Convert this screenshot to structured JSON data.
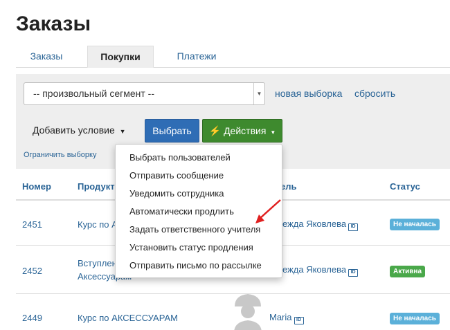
{
  "page": {
    "title": "Заказы"
  },
  "tabs": [
    {
      "label": "Заказы",
      "active": false
    },
    {
      "label": "Покупки",
      "active": true
    },
    {
      "label": "Платежи",
      "active": false
    }
  ],
  "filter": {
    "segment_value": "-- произвольный сегмент --",
    "new_selection": "новая выборка",
    "reset": "сбросить",
    "add_condition": "Добавить условие",
    "select_button": "Выбрать",
    "actions_button": "Действия",
    "limit_selection": "Ограничить выборку"
  },
  "table": {
    "headers": {
      "number": "Номер",
      "product": "Продукт",
      "user": "ель",
      "status": "Статус"
    },
    "rows": [
      {
        "number": "2451",
        "product_line1": "Курс по А",
        "product_line2": "",
        "user": "ежда Яковлева",
        "status": "Не началась",
        "status_color": "#5bb0d9"
      },
      {
        "number": "2452",
        "product_line1": "Вступлен",
        "product_line2": "Аксессуарам",
        "user": "ежда Яковлева",
        "status": "Активна",
        "status_color": "#4aa84a"
      },
      {
        "number": "2449",
        "product_line1": "Курс по АКСЕССУАРАМ",
        "product_line2": "",
        "user": "Maria",
        "status": "Не началась",
        "status_color": "#5bb0d9"
      }
    ]
  },
  "actions_menu": {
    "items": [
      "Выбрать пользователей",
      "Отправить сообщение",
      "Уведомить сотрудника",
      "Автоматически продлить",
      "Задать ответственного учителя",
      "Установить статус продления",
      "Отправить письмо по рассылке"
    ]
  },
  "colors": {
    "link": "#2a6496",
    "primary_button": "#2f6db5",
    "actions_button": "#3e8a2e",
    "annotation_arrow": "#e02020"
  },
  "icons": {
    "dropdown": "caret-down-icon",
    "actions": "lightning-icon",
    "user_id": "id-card-icon",
    "annotation": "red-arrow-icon"
  }
}
